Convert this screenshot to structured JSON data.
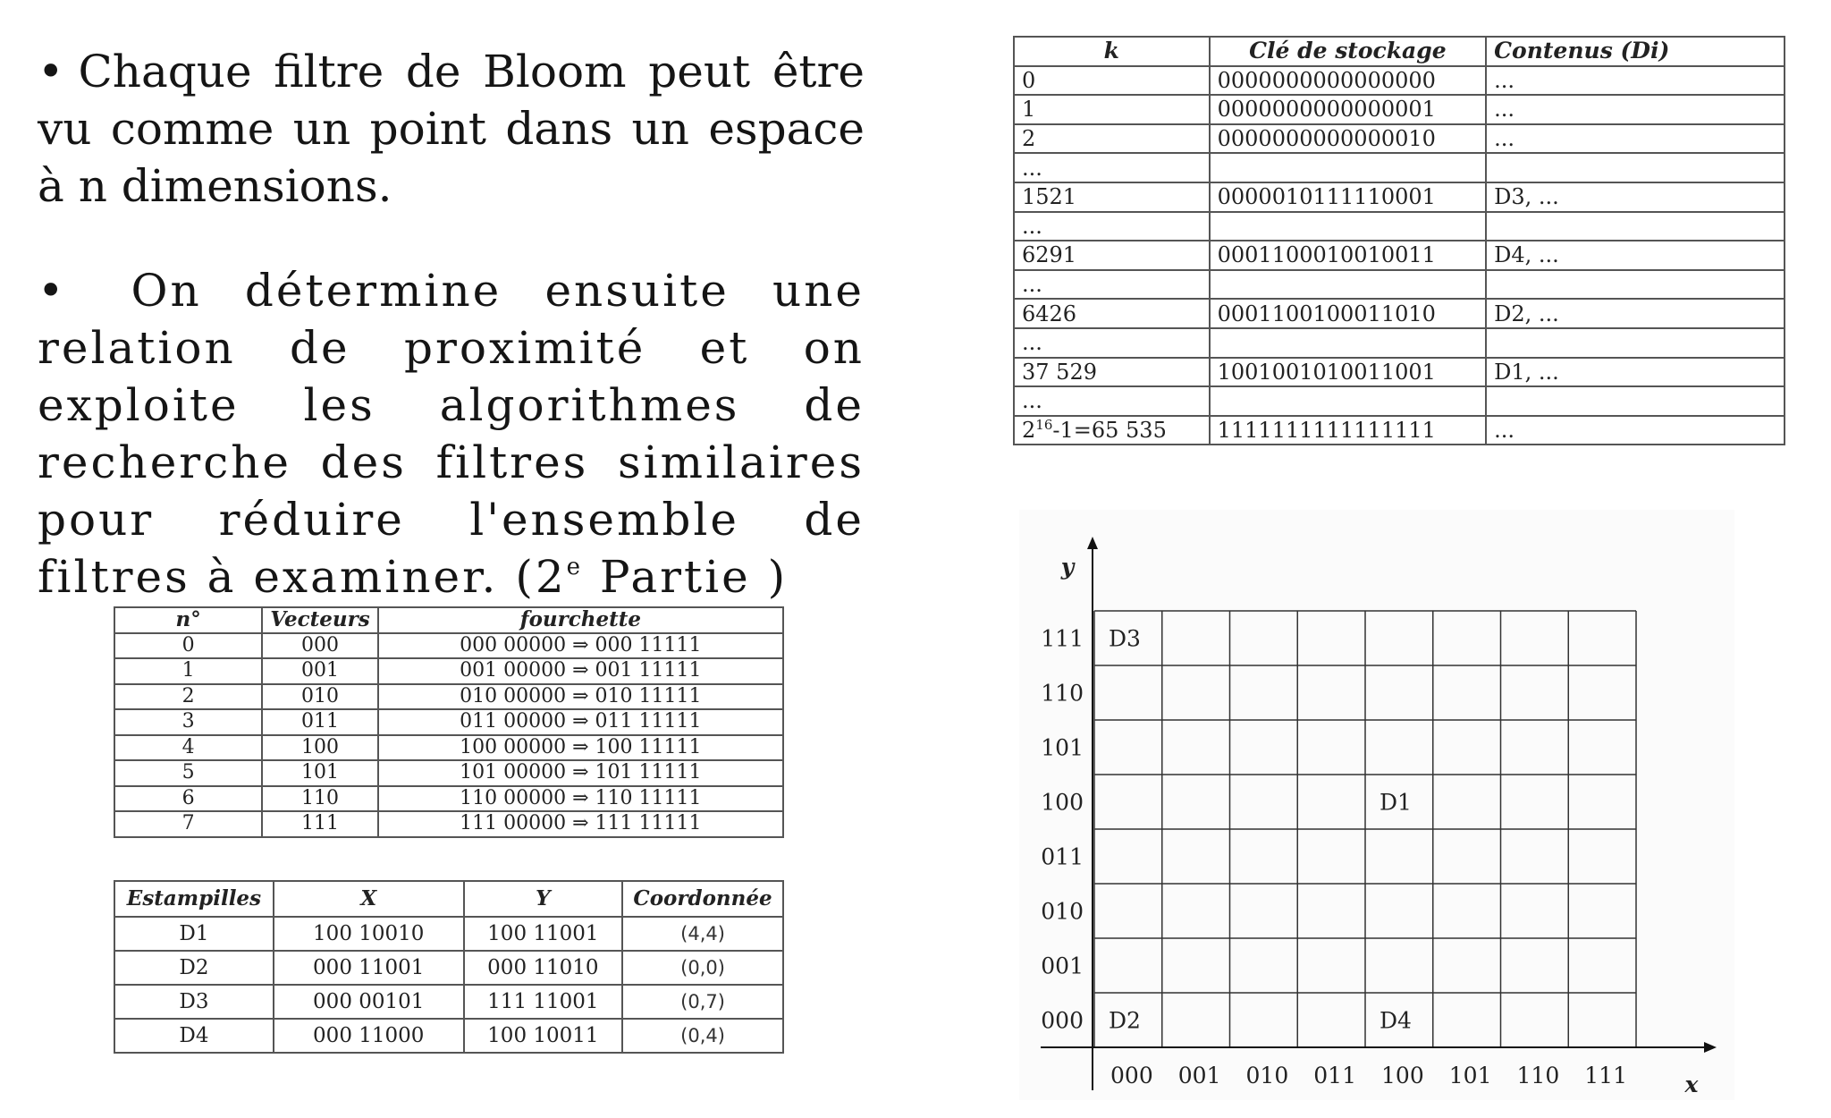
{
  "text": {
    "bullet_symbol": "•",
    "bullet1": "Chaque filtre de Bloom peut être vu comme un point dans un espace à n dimensions.",
    "bullet2_main": "On détermine ensuite une relation de proximité et on exploite les algorithmes de recherche des filtres similaires pour réduire l'ensemble de filtres à examiner. (2",
    "bullet2_sup": "e",
    "bullet2_tail": " Partie )"
  },
  "storage_table": {
    "headers": [
      "k",
      "Clé de stockage",
      "Contenus (Di)"
    ],
    "rows": [
      [
        "0",
        "0000000000000000",
        "..."
      ],
      [
        "1",
        "0000000000000001",
        "..."
      ],
      [
        "2",
        "0000000000000010",
        "..."
      ],
      [
        "...",
        "",
        ""
      ],
      [
        "1521",
        "0000010111110001",
        "D3, ..."
      ],
      [
        "...",
        "",
        ""
      ],
      [
        "6291",
        "0001100010010011",
        "D4, ..."
      ],
      [
        "...",
        "",
        ""
      ],
      [
        "6426",
        "0001100100011010",
        "D2, ..."
      ],
      [
        "...",
        "",
        ""
      ],
      [
        "37 529",
        "1001001010011001",
        "D1, ..."
      ],
      [
        "...",
        "",
        ""
      ],
      [
        "",
        "1111111111111111",
        "..."
      ]
    ],
    "last_k_base": "2",
    "last_k_exp": "16",
    "last_k_rest": "-1=65 535"
  },
  "vector_table": {
    "headers": [
      "n°",
      "Vecteurs",
      "fourchette"
    ],
    "rows": [
      [
        "0",
        "000",
        "000 00000 ⇒ 000  11111"
      ],
      [
        "1",
        "001",
        "001 00000 ⇒ 001 11111"
      ],
      [
        "2",
        "010",
        "010 00000 ⇒ 010 11111"
      ],
      [
        "3",
        "011",
        "011 00000 ⇒ 011 11111"
      ],
      [
        "4",
        "100",
        "100 00000 ⇒ 100 11111"
      ],
      [
        "5",
        "101",
        "101 00000 ⇒ 101 11111"
      ],
      [
        "6",
        "110",
        "110 00000 ⇒ 110 11111"
      ],
      [
        "7",
        "111",
        "111 00000 ⇒ 111 11111"
      ]
    ]
  },
  "stamp_table": {
    "headers": [
      "Estampilles",
      "X",
      "Y",
      "Coordonnée"
    ],
    "rows": [
      [
        "D1",
        "100 10010",
        "100 11001",
        "(4,4)"
      ],
      [
        "D2",
        "000 11001",
        "000 11010",
        "(0,0)"
      ],
      [
        "D3",
        "000 00101",
        "111 11001",
        "(0,7)"
      ],
      [
        "D4",
        "000 11000",
        "100 10011",
        "(0,4)"
      ]
    ]
  },
  "grid": {
    "y_axis_label": "y",
    "x_axis_label": "x",
    "y_ticks": [
      "111",
      "110",
      "101",
      "100",
      "011",
      "010",
      "001",
      "000"
    ],
    "x_ticks": [
      "000",
      "001",
      "010",
      "011",
      "100",
      "101",
      "110",
      "111"
    ],
    "points": [
      {
        "label": "D3",
        "col": 0,
        "row": 7
      },
      {
        "label": "D1",
        "col": 4,
        "row": 4
      },
      {
        "label": "D2",
        "col": 0,
        "row": 0
      },
      {
        "label": "D4",
        "col": 4,
        "row": 0
      }
    ]
  }
}
